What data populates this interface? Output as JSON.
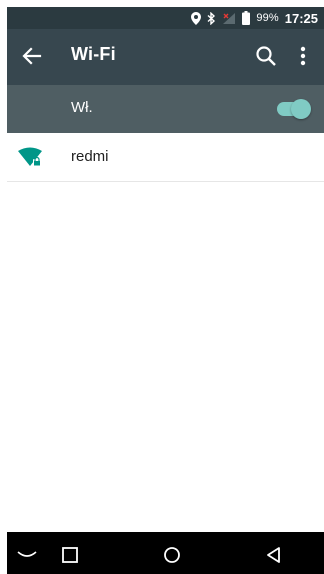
{
  "status_bar": {
    "battery_percent": "99%",
    "time": "17:25",
    "icons": [
      "location-icon",
      "bluetooth-icon",
      "signal-off-icon",
      "battery-icon"
    ]
  },
  "toolbar": {
    "title": "Wi-Fi",
    "back_icon": "arrow-back-icon",
    "search_icon": "search-icon",
    "more_icon": "more-vert-icon"
  },
  "wifi_switch": {
    "label": "Wł.",
    "enabled": true
  },
  "networks": [
    {
      "ssid": "redmi",
      "secured": true,
      "icon": "wifi-lock-icon"
    }
  ],
  "nav_bar": {
    "icons": [
      "hide-keyboard-icon",
      "recents-icon",
      "home-icon",
      "back-icon"
    ]
  },
  "colors": {
    "status_bar": "#2b3a40",
    "toolbar": "#37474f",
    "switch_bar": "#4f5e63",
    "accent": "#80cbc4",
    "wifi_icon": "#009688"
  }
}
